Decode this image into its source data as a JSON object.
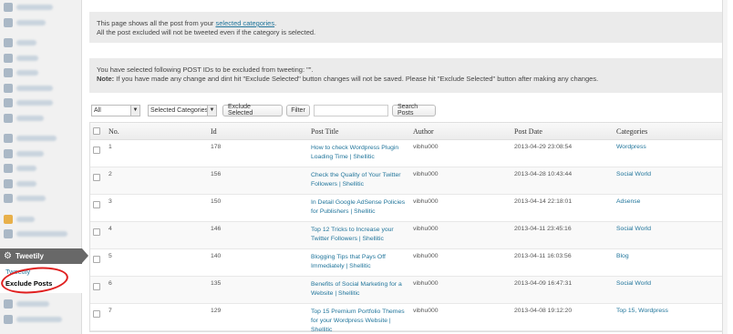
{
  "sidebar": {
    "active_label": "Tweetily",
    "submenu": [
      "Tweetily",
      "Exclude Posts"
    ]
  },
  "notice1": {
    "line1_prefix": "This page shows all the post from your ",
    "line1_link": "selected categories",
    "line1_suffix": ".",
    "line2": "All the post excluded will not be tweeted even if the category is selected."
  },
  "notice2": {
    "line1": "You have selected following POST IDs to be excluded from tweeting: \"\".",
    "note_label": "Note:",
    "note_text": " If you have made any change and dint hit \"Exclude Selected\" button changes will not be saved. Please hit \"Exclude Selected\" button after making any changes."
  },
  "toolbar": {
    "filter_select": "All",
    "category_select": "Selected Categories",
    "exclude_button": "Exclude Selected",
    "filter_button": "Filter",
    "search_value": "",
    "search_button": "Search Posts"
  },
  "table": {
    "headers": [
      "No.",
      "Id",
      "Post Title",
      "Author",
      "Post Date",
      "Categories"
    ],
    "rows": [
      {
        "no": "1",
        "id": "178",
        "title": "How to check Wordpress Plugin Loading Time | Shellitic",
        "author": "vibhu000",
        "date": "2013-04-29 23:08:54",
        "category": "Wordpress"
      },
      {
        "no": "2",
        "id": "156",
        "title": "Check the Quality of Your Twitter Followers | Shellitic",
        "author": "vibhu000",
        "date": "2013-04-28 10:43:44",
        "category": "Social World"
      },
      {
        "no": "3",
        "id": "150",
        "title": "In Detail Google AdSense Policies for Publishers | Shellitic",
        "author": "vibhu000",
        "date": "2013-04-14 22:18:01",
        "category": "Adsense"
      },
      {
        "no": "4",
        "id": "146",
        "title": "Top 12 Tricks to Increase your Twitter Followers | Shellitic",
        "author": "vibhu000",
        "date": "2013-04-11 23:45:16",
        "category": "Social World"
      },
      {
        "no": "5",
        "id": "140",
        "title": "Blogging Tips that Pays Off Immediately | Shellitic",
        "author": "vibhu000",
        "date": "2013-04-11 16:03:56",
        "category": "Blog"
      },
      {
        "no": "6",
        "id": "135",
        "title": "Benefits of Social Marketing for a Website | Shellitic",
        "author": "vibhu000",
        "date": "2013-04-09 16:47:31",
        "category": "Social World"
      },
      {
        "no": "7",
        "id": "129",
        "title": "Top 15 Premium Portfolio Themes for your Wordpress Website | Shellitic",
        "author": "vibhu000",
        "date": "2013-04-08 19:12:20",
        "category": "Top 15, Wordpress"
      }
    ]
  }
}
